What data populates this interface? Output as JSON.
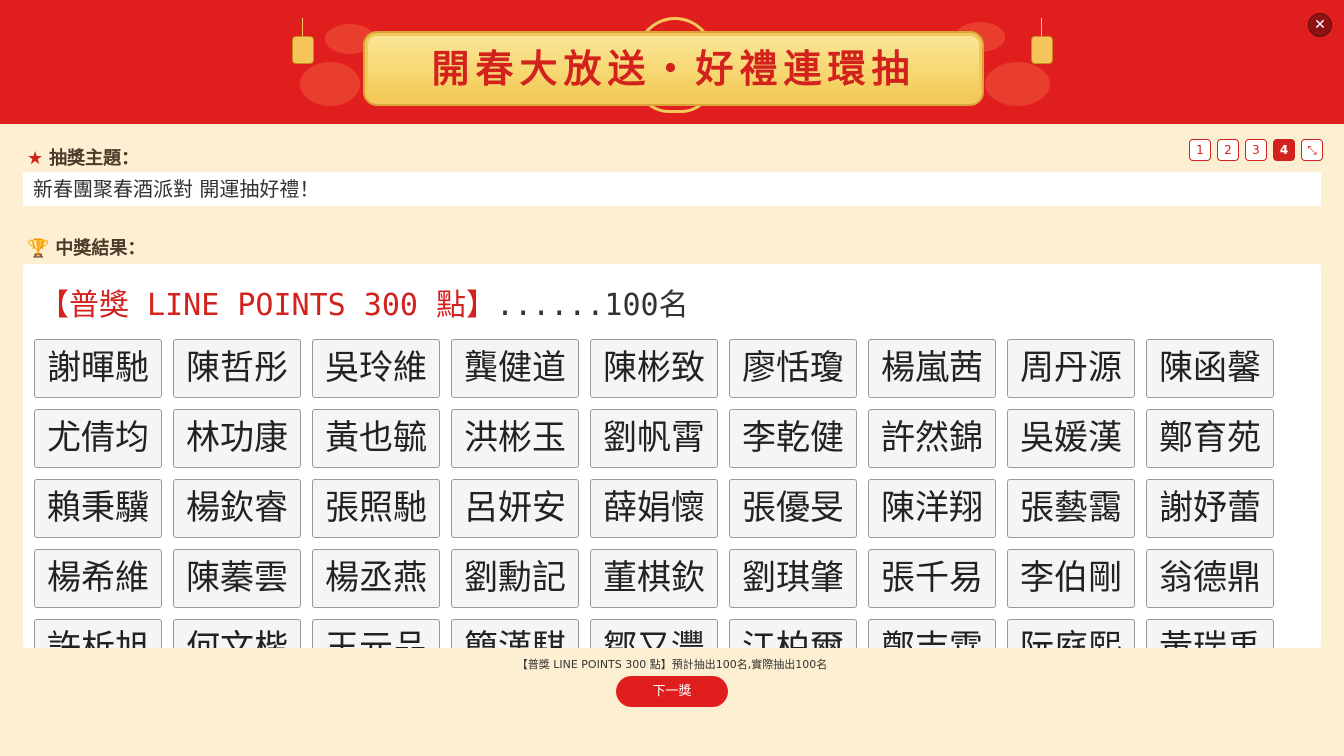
{
  "header": {
    "banner_title": "開春大放送・好禮連環抽",
    "close_label": "✕"
  },
  "theme": {
    "label": "抽獎主題：",
    "value": "新春團聚春酒派對 開運抽好禮！"
  },
  "results": {
    "label": "中獎結果：",
    "prize_name": "【普獎 LINE POINTS 300 點】",
    "prize_count": "......100名",
    "winners": [
      "謝暉馳",
      "陳哲彤",
      "吳玲維",
      "龔健道",
      "陳彬致",
      "廖恬瓊",
      "楊嵐茜",
      "周丹源",
      "陳函馨",
      "尤倩均",
      "林功康",
      "黃也毓",
      "洪彬玉",
      "劉帆霄",
      "李乾健",
      "許然錦",
      "吳媛漢",
      "鄭育苑",
      "賴秉驥",
      "楊欽睿",
      "張照馳",
      "呂妍安",
      "薛娟懷",
      "張優旻",
      "陳洋翔",
      "張藝靄",
      "謝妤蕾",
      "楊希維",
      "陳蓁雲",
      "楊丞燕",
      "劉勳記",
      "董棋欽",
      "劉琪肇",
      "張千易",
      "李伯剛",
      "翁德鼎",
      "許析旭",
      "何文楷",
      "王元品",
      "簡漢騏",
      "鄒又灃",
      "江柏爾",
      "鄭吉霖",
      "阮庭熙",
      "黃瑞禹"
    ]
  },
  "pager": {
    "pages": [
      "1",
      "2",
      "3",
      "4"
    ],
    "active_index": 3,
    "collapse_label": "⤡"
  },
  "footer": {
    "status": "【普獎 LINE POINTS 300 點】預計抽出100名,實際抽出100名",
    "next_label": "下一獎"
  },
  "colors": {
    "header_red": "#e01e1e",
    "accent_red": "#d3211d",
    "background": "#fdf0d2"
  }
}
